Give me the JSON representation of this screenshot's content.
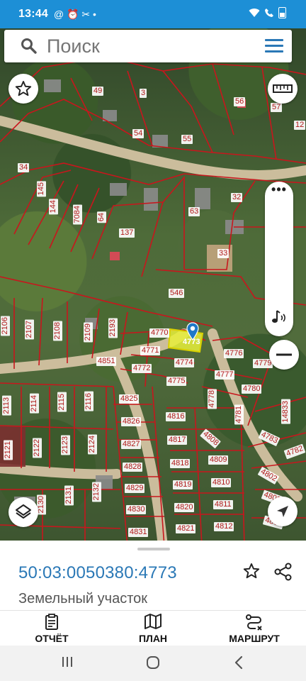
{
  "status_bar": {
    "time": "13:44",
    "notifications": "@ ⏰ ✂ •",
    "system": "📶 ☎ ▮"
  },
  "search": {
    "placeholder": "Поиск"
  },
  "map": {
    "lots": [
      {
        "label": "49"
      },
      {
        "label": "3"
      },
      {
        "label": "56"
      },
      {
        "label": "57"
      },
      {
        "label": "12"
      },
      {
        "label": "54"
      },
      {
        "label": "55"
      },
      {
        "label": "34"
      },
      {
        "label": "145"
      },
      {
        "label": "144"
      },
      {
        "label": "7084"
      },
      {
        "label": "64"
      },
      {
        "label": "137"
      },
      {
        "label": "63"
      },
      {
        "label": "32"
      },
      {
        "label": "33"
      },
      {
        "label": "546"
      },
      {
        "label": "2106"
      },
      {
        "label": "2107"
      },
      {
        "label": "2108"
      },
      {
        "label": "2109"
      },
      {
        "label": "2193"
      },
      {
        "label": "4770"
      },
      {
        "label": "4773"
      },
      {
        "label": "4771"
      },
      {
        "label": "4776"
      },
      {
        "label": "4779"
      },
      {
        "label": "4851"
      },
      {
        "label": "4772"
      },
      {
        "label": "4774"
      },
      {
        "label": "4777"
      },
      {
        "label": "4775"
      },
      {
        "label": "4780"
      },
      {
        "label": "4778"
      },
      {
        "label": "4781"
      },
      {
        "label": "14833"
      },
      {
        "label": "2113"
      },
      {
        "label": "2114"
      },
      {
        "label": "2115"
      },
      {
        "label": "2116"
      },
      {
        "label": "4825"
      },
      {
        "label": "4816"
      },
      {
        "label": "4826"
      },
      {
        "label": "4817"
      },
      {
        "label": "4808"
      },
      {
        "label": "4783"
      },
      {
        "label": "4782"
      },
      {
        "label": "2121"
      },
      {
        "label": "2122"
      },
      {
        "label": "2123"
      },
      {
        "label": "2124"
      },
      {
        "label": "4827"
      },
      {
        "label": "4828"
      },
      {
        "label": "4818"
      },
      {
        "label": "4809"
      },
      {
        "label": "4802"
      },
      {
        "label": "4829"
      },
      {
        "label": "4819"
      },
      {
        "label": "4810"
      },
      {
        "label": "2130"
      },
      {
        "label": "2131"
      },
      {
        "label": "2132"
      },
      {
        "label": "4830"
      },
      {
        "label": "4820"
      },
      {
        "label": "4811"
      },
      {
        "label": "4803"
      },
      {
        "label": "4831"
      },
      {
        "label": "4821"
      },
      {
        "label": "4812"
      },
      {
        "label": "4804"
      }
    ],
    "selected_lot": "4773",
    "colors": {
      "boundary": "#c8161d",
      "selected_fill": "#e8f03a",
      "road": "#d9c7aa",
      "marker": "#1f78c8"
    }
  },
  "controls": {
    "favorite_icon": "star-outline-icon",
    "ruler_icon": "ruler-icon",
    "more_icon": "more-dots-icon",
    "sound_icon": "sound-note-icon",
    "zoom_out_icon": "minus-icon",
    "layers_icon": "layers-icon",
    "location_icon": "navigation-arrow-icon"
  },
  "info": {
    "cadastral_number": "50:03:0050380:4773",
    "type": "Земельный участок"
  },
  "actions": [
    {
      "label": "ОТЧЁТ",
      "icon": "report-clipboard-icon"
    },
    {
      "label": "ПЛАН",
      "icon": "map-plan-icon"
    },
    {
      "label": "МАРШРУТ",
      "icon": "route-icon"
    }
  ],
  "navigation": [
    "recent-apps-icon",
    "home-icon",
    "back-icon"
  ]
}
